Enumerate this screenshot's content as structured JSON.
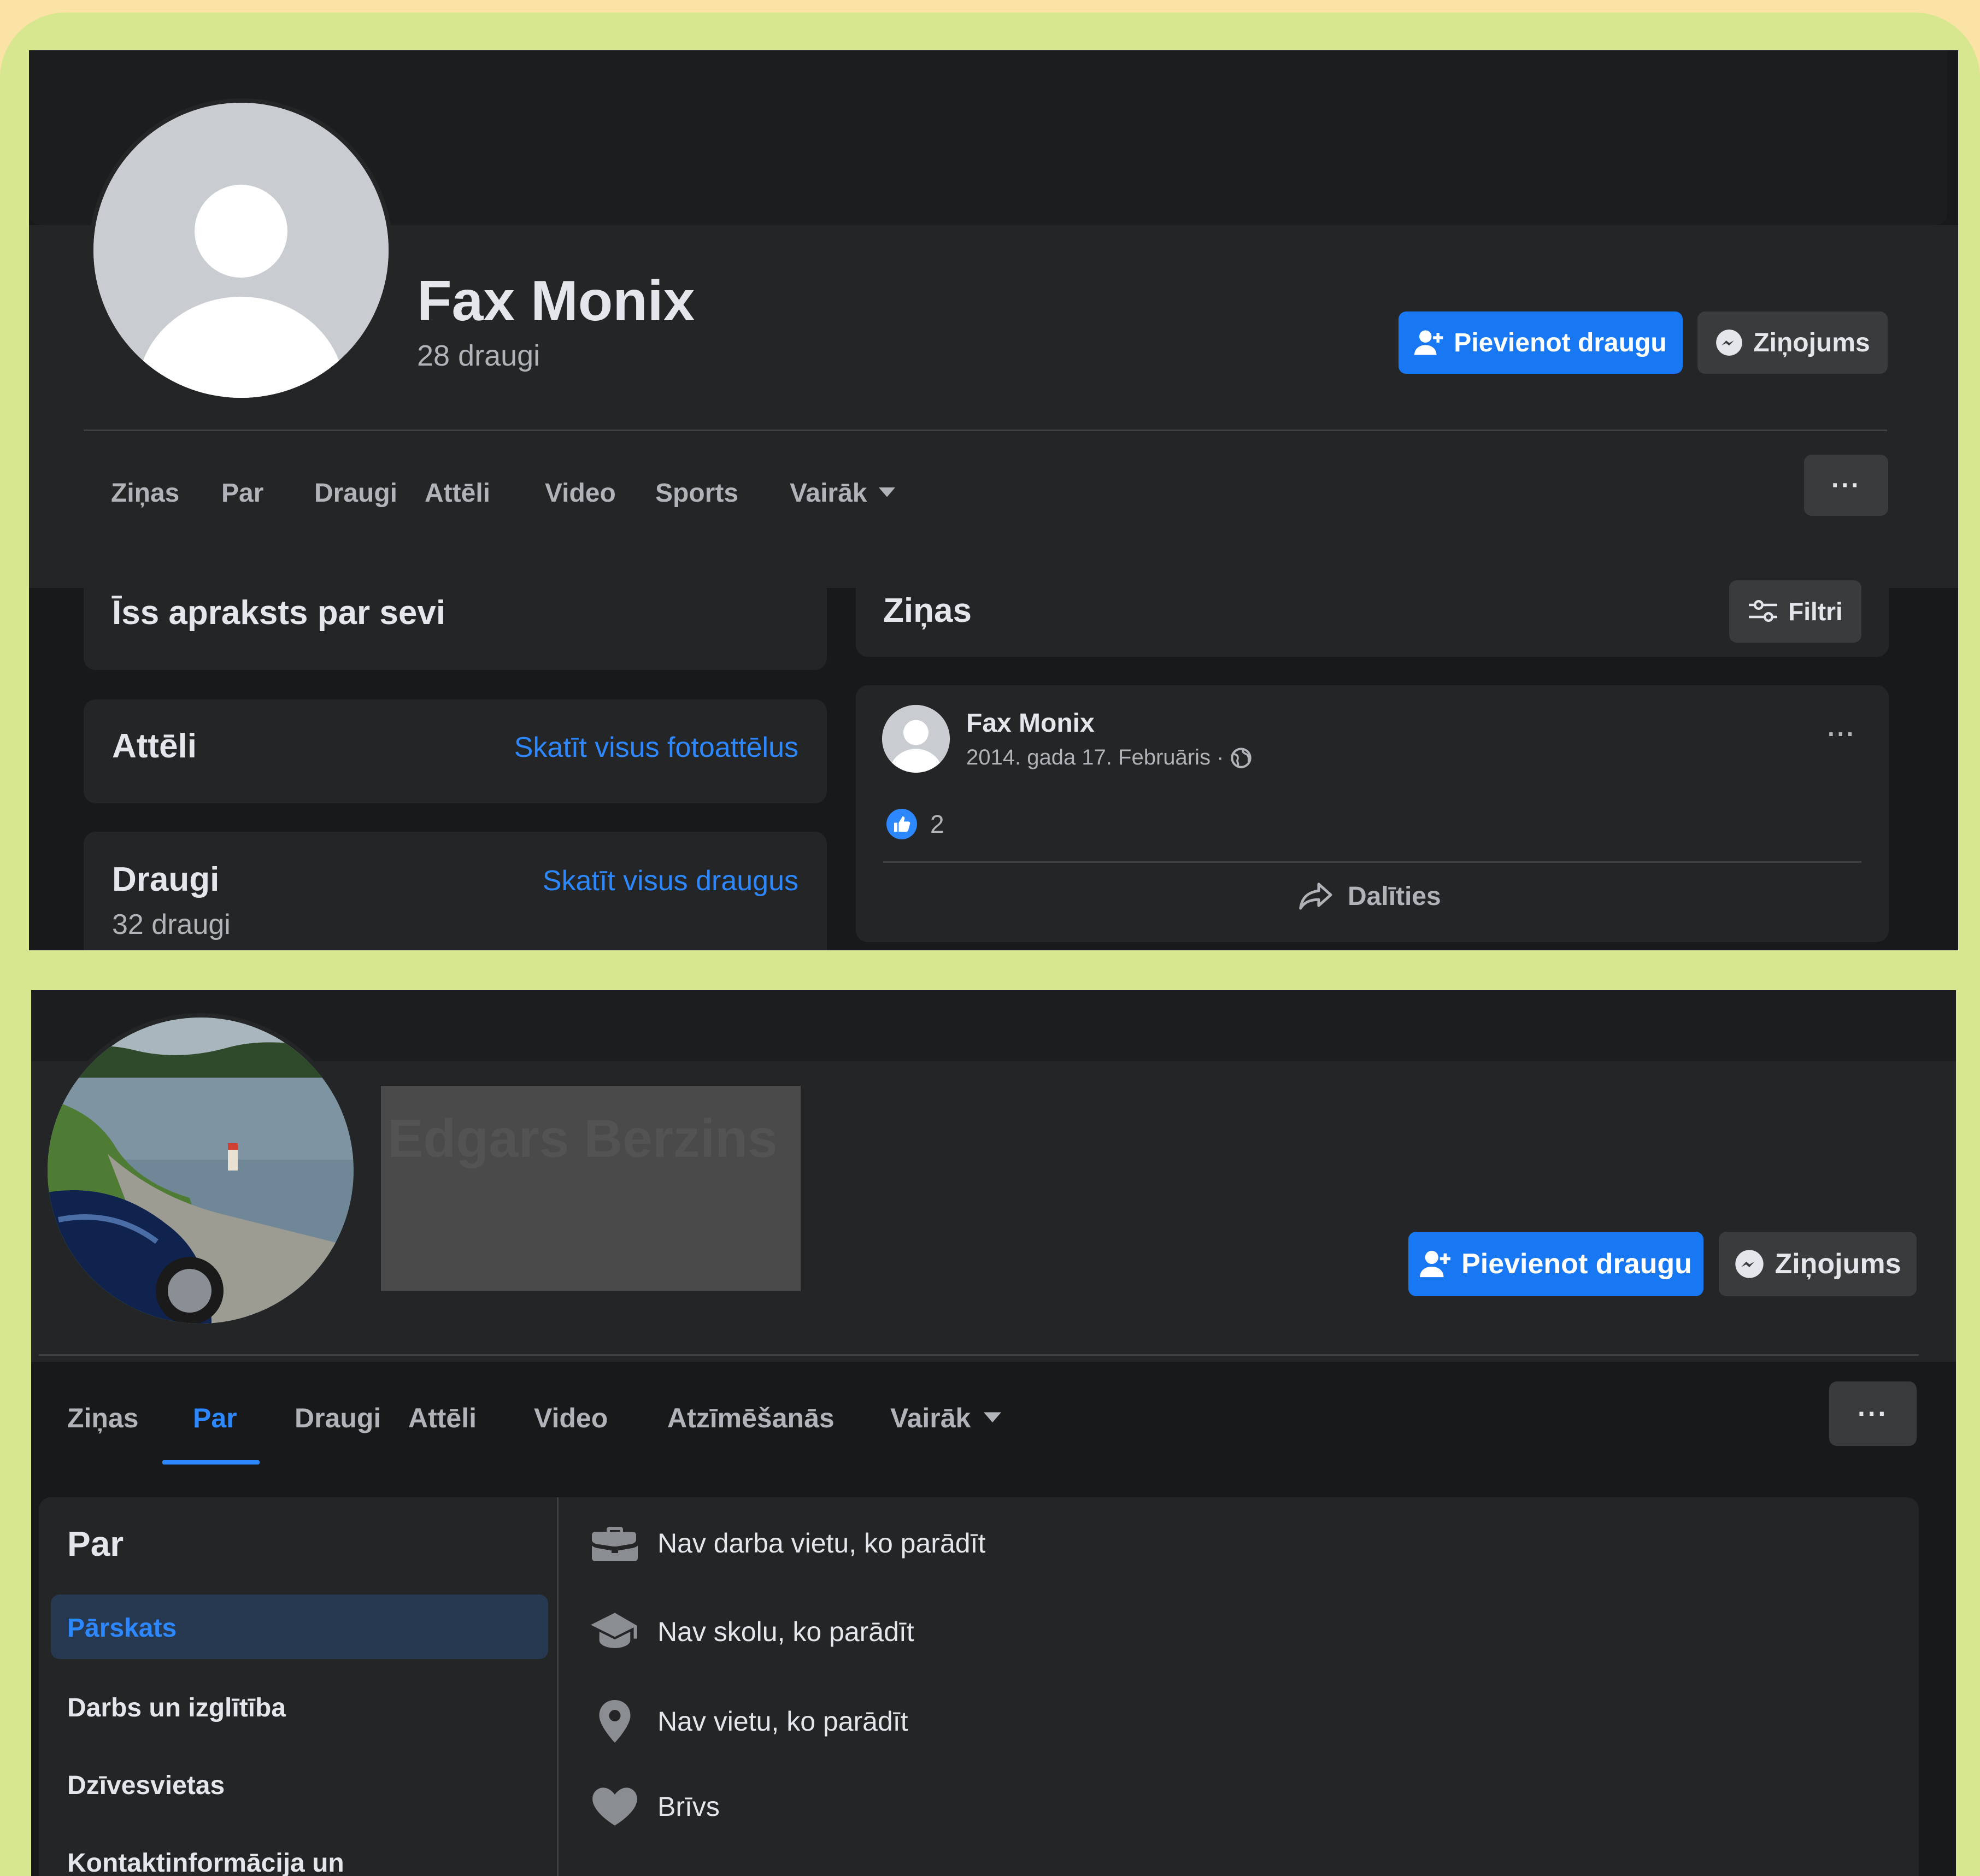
{
  "profile1": {
    "name": "Fax Monix",
    "friends_count": "28 draugi",
    "add_friend_label": "Pievienot draugu",
    "message_label": "Ziņojums",
    "more_label": "···",
    "tabs": [
      {
        "label": "Ziņas"
      },
      {
        "label": "Par"
      },
      {
        "label": "Draugi"
      },
      {
        "label": "Attēli"
      },
      {
        "label": "Video"
      },
      {
        "label": "Sports"
      },
      {
        "label": "Vairāk"
      }
    ],
    "intro_title": "Īss apraksts par sevi",
    "photos_title": "Attēli",
    "photos_link": "Skatīt visus fotoattēlus",
    "friends_title": "Draugi",
    "friends_link": "Skatīt visus draugus",
    "friends_sub": "32 draugi",
    "posts_title": "Ziņas",
    "filters_label": "Filtri",
    "post": {
      "author": "Fax Monix",
      "date": "2014. gada 17. Februāris ·",
      "likes": "2",
      "share_label": "Dalīties",
      "more": "···"
    }
  },
  "profile2": {
    "name_redacted": "Edgars Berzins",
    "add_friend_label": "Pievienot draugu",
    "message_label": "Ziņojums",
    "more_label": "···",
    "tabs": [
      {
        "label": "Ziņas"
      },
      {
        "label": "Par"
      },
      {
        "label": "Draugi"
      },
      {
        "label": "Attēli"
      },
      {
        "label": "Video"
      },
      {
        "label": "Atzīmēšanās"
      },
      {
        "label": "Vairāk"
      }
    ],
    "about": {
      "title": "Par",
      "nav": [
        {
          "label": "Pārskats"
        },
        {
          "label": "Darbs un izglītība"
        },
        {
          "label": "Dzīvesvietas"
        },
        {
          "label": "Kontaktinformācija un"
        }
      ],
      "rows": [
        {
          "icon": "briefcase-icon",
          "text": "Nav darba vietu, ko parādīt"
        },
        {
          "icon": "graduation-cap-icon",
          "text": "Nav skolu, ko parādīt"
        },
        {
          "icon": "location-pin-icon",
          "text": "Nav vietu, ko parādīt"
        },
        {
          "icon": "heart-icon",
          "text": "Brīvs"
        }
      ]
    }
  },
  "colors": {
    "accent": "#1877f2",
    "link": "#2d88ff",
    "card": "#242526",
    "page": "#18191a",
    "frame": "#d6e78f"
  }
}
